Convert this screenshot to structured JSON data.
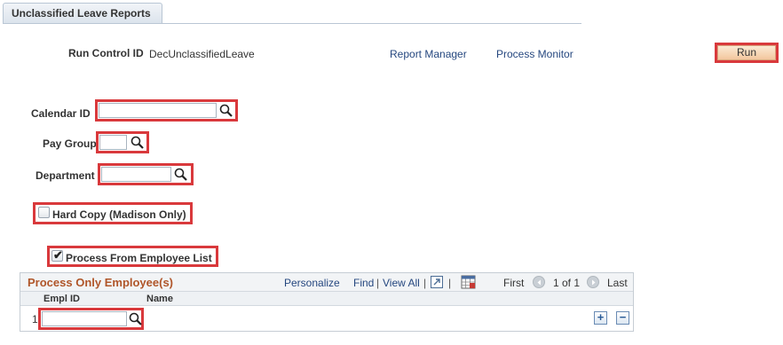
{
  "tab": {
    "label": "Unclassified Leave Reports"
  },
  "run_control": {
    "label": "Run Control ID",
    "value": "DecUnclassifiedLeave"
  },
  "links": {
    "report_manager": "Report Manager",
    "process_monitor": "Process Monitor"
  },
  "run_button": {
    "label": "Run"
  },
  "calendar": {
    "label": "Calendar ID",
    "value": ""
  },
  "pay_group": {
    "label": "Pay Group",
    "value": ""
  },
  "department": {
    "label": "Department",
    "value": ""
  },
  "hard_copy": {
    "label": "Hard Copy (Madison Only)",
    "checked": false
  },
  "process_list": {
    "label": "Process From Employee List",
    "checked": true
  },
  "grid": {
    "title": "Process Only Employee(s)",
    "personalize": "Personalize",
    "find": "Find",
    "sep1": "|",
    "view_all": "View All",
    "sep2": "|",
    "sep3": "|",
    "first": "First",
    "page_info": "1 of 1",
    "last": "Last",
    "columns": [
      "Empl ID",
      "Name"
    ],
    "rows": [
      {
        "num": "1",
        "empl_id": "",
        "name": ""
      }
    ],
    "add": "+",
    "remove": "−"
  },
  "colors": {
    "highlight": "#d9393c",
    "link": "#25477f",
    "grid_title": "#b0562a"
  }
}
